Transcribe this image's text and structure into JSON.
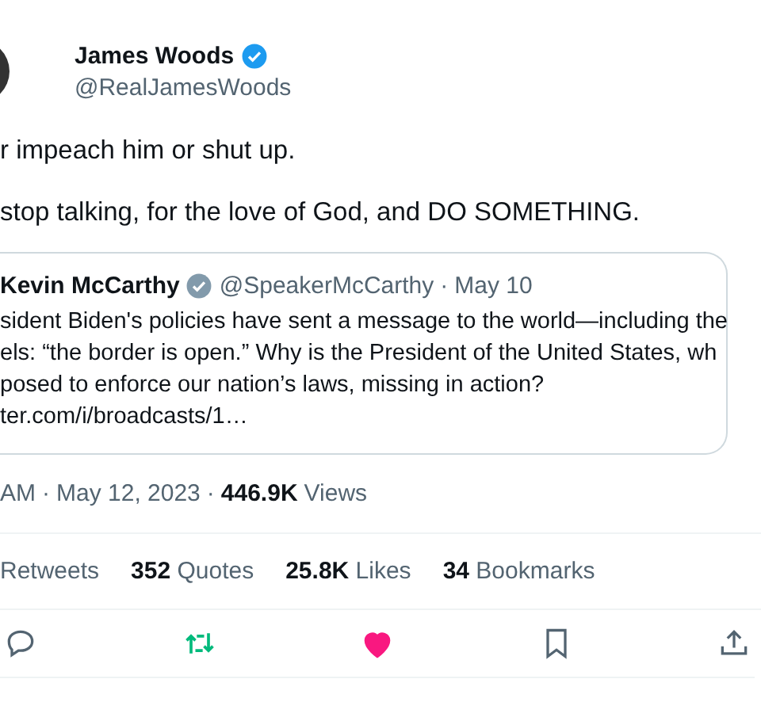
{
  "author": {
    "name": "James Woods",
    "verified": true,
    "handle": "@RealJamesWoods"
  },
  "text": [
    "r impeach him or shut up.",
    "stop talking, for the love of God, and DO SOMETHING."
  ],
  "quote": {
    "name": "Kevin McCarthy",
    "verified": true,
    "handle": "@SpeakerMcCarthy",
    "date": "May 10",
    "separator": "·",
    "lines": [
      "sident Biden's policies have sent a message to the world—including the",
      "els: “the border is open.”  Why is the President of the United States, wh",
      "posed to enforce our nation’s laws, missing in action?",
      "ter.com/i/broadcasts/1…"
    ]
  },
  "meta": {
    "time": "AM",
    "separator": "·",
    "date": "May 12, 2023",
    "views_count": "446.9K",
    "views_label": "Views"
  },
  "stats": [
    {
      "label": "Retweets"
    },
    {
      "count": "352",
      "label": "Quotes"
    },
    {
      "count": "25.8K",
      "label": "Likes"
    },
    {
      "count": "34",
      "label": "Bookmarks"
    }
  ],
  "actions": [
    {
      "kind": "reply",
      "on": false
    },
    {
      "kind": "retweet",
      "on": true
    },
    {
      "kind": "like",
      "on": true
    },
    {
      "kind": "bookmark",
      "on": false
    },
    {
      "kind": "share",
      "on": false
    }
  ]
}
